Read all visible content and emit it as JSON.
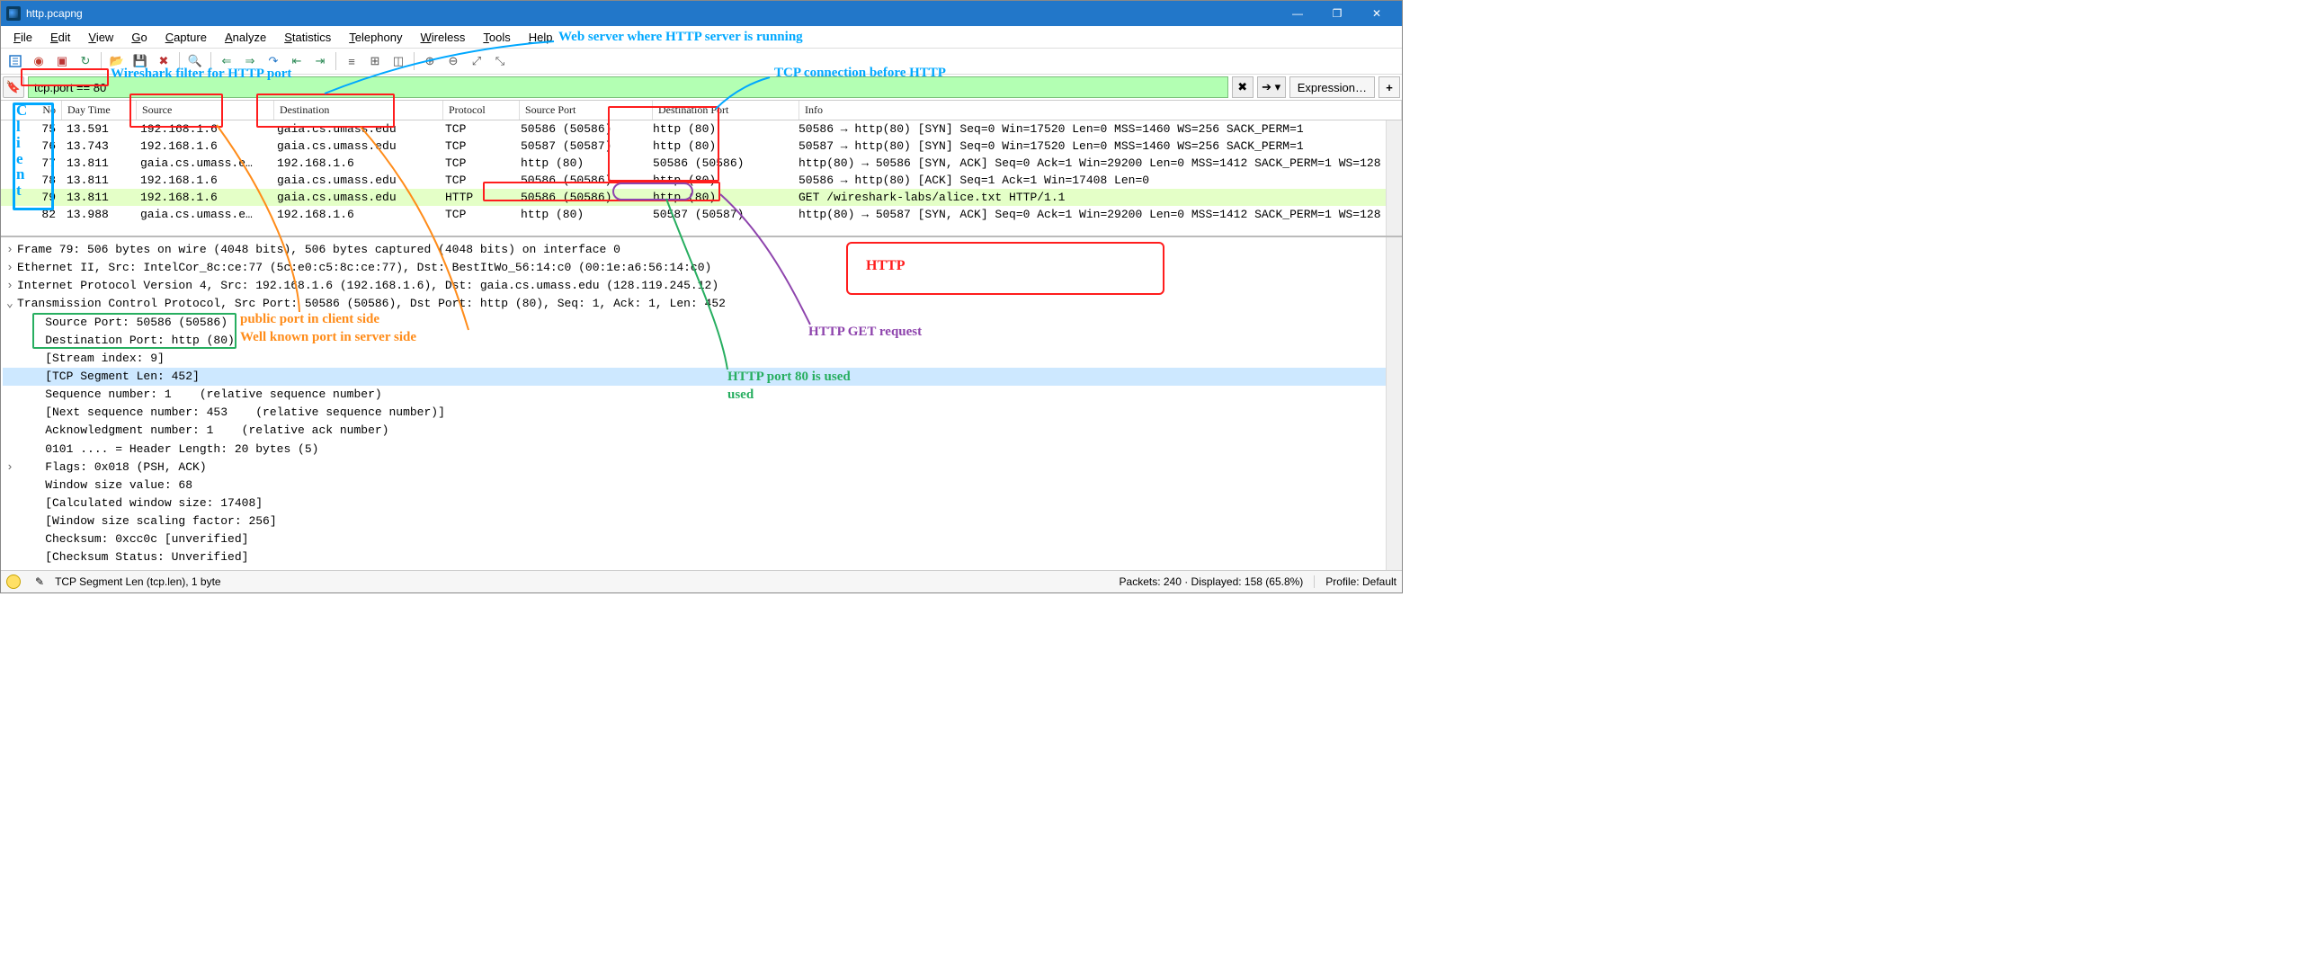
{
  "window": {
    "title": "http.pcapng"
  },
  "menu": [
    "File",
    "Edit",
    "View",
    "Go",
    "Capture",
    "Analyze",
    "Statistics",
    "Telephony",
    "Wireless",
    "Tools",
    "Help"
  ],
  "filter": {
    "value": "tcp.port == 80",
    "expression_label": "Expression…"
  },
  "columns": [
    "No",
    "Day Time",
    "Source",
    "Destination",
    "Protocol",
    "Source Port",
    "Destination Port",
    "Info"
  ],
  "packets": [
    {
      "no": "75",
      "dt": "13.591",
      "src": "192.168.1.6",
      "dst": "gaia.cs.umass.edu",
      "proto": "TCP",
      "sp": "50586 (50586)",
      "dp": "http (80)",
      "info": "50586 → http(80) [SYN] Seq=0 Win=17520 Len=0 MSS=1460 WS=256 SACK_PERM=1"
    },
    {
      "no": "76",
      "dt": "13.743",
      "src": "192.168.1.6",
      "dst": "gaia.cs.umass.edu",
      "proto": "TCP",
      "sp": "50587 (50587)",
      "dp": "http (80)",
      "info": "50587 → http(80) [SYN] Seq=0 Win=17520 Len=0 MSS=1460 WS=256 SACK_PERM=1"
    },
    {
      "no": "77",
      "dt": "13.811",
      "src": "gaia.cs.umass.e…",
      "dst": "192.168.1.6",
      "proto": "TCP",
      "sp": "http (80)",
      "dp": "50586 (50586)",
      "info": "http(80) → 50586 [SYN, ACK] Seq=0 Ack=1 Win=29200 Len=0 MSS=1412 SACK_PERM=1 WS=128"
    },
    {
      "no": "78",
      "dt": "13.811",
      "src": "192.168.1.6",
      "dst": "gaia.cs.umass.edu",
      "proto": "TCP",
      "sp": "50586 (50586)",
      "dp": "http (80)",
      "info": "50586 → http(80) [ACK] Seq=1 Ack=1 Win=17408 Len=0"
    },
    {
      "no": "79",
      "dt": "13.811",
      "src": "192.168.1.6",
      "dst": "gaia.cs.umass.edu",
      "proto": "HTTP",
      "sp": "50586 (50586)",
      "dp": "http (80)",
      "info": "GET /wireshark-labs/alice.txt HTTP/1.1",
      "http": true
    },
    {
      "no": "82",
      "dt": "13.988",
      "src": "gaia.cs.umass.e…",
      "dst": "192.168.1.6",
      "proto": "TCP",
      "sp": "http (80)",
      "dp": "50587 (50587)",
      "info": "http(80) → 50587 [SYN, ACK] Seq=0 Ack=1 Win=29200 Len=0 MSS=1412 SACK_PERM=1 WS=128"
    }
  ],
  "details": [
    {
      "indent": 0,
      "exp": ">",
      "text": "Frame 79: 506 bytes on wire (4048 bits), 506 bytes captured (4048 bits) on interface 0"
    },
    {
      "indent": 0,
      "exp": ">",
      "text": "Ethernet II, Src: IntelCor_8c:ce:77 (5c:e0:c5:8c:ce:77), Dst: BestItWo_56:14:c0 (00:1e:a6:56:14:c0)"
    },
    {
      "indent": 0,
      "exp": ">",
      "text": "Internet Protocol Version 4, Src: 192.168.1.6 (192.168.1.6), Dst: gaia.cs.umass.edu (128.119.245.12)"
    },
    {
      "indent": 0,
      "exp": "v",
      "text": "Transmission Control Protocol, Src Port: 50586 (50586), Dst Port: http (80), Seq: 1, Ack: 1, Len: 452"
    },
    {
      "indent": 1,
      "text": "Source Port: 50586 (50586)"
    },
    {
      "indent": 1,
      "text": "Destination Port: http (80)"
    },
    {
      "indent": 1,
      "text": "[Stream index: 9]"
    },
    {
      "indent": 1,
      "text": "[TCP Segment Len: 452]",
      "hl": true
    },
    {
      "indent": 1,
      "text": "Sequence number: 1    (relative sequence number)"
    },
    {
      "indent": 1,
      "text": "[Next sequence number: 453    (relative sequence number)]"
    },
    {
      "indent": 1,
      "text": "Acknowledgment number: 1    (relative ack number)"
    },
    {
      "indent": 1,
      "text": "0101 .... = Header Length: 20 bytes (5)"
    },
    {
      "indent": 1,
      "exp": ">",
      "text": "Flags: 0x018 (PSH, ACK)"
    },
    {
      "indent": 1,
      "text": "Window size value: 68"
    },
    {
      "indent": 1,
      "text": "[Calculated window size: 17408]"
    },
    {
      "indent": 1,
      "text": "[Window size scaling factor: 256]"
    },
    {
      "indent": 1,
      "text": "Checksum: 0xcc0c [unverified]"
    },
    {
      "indent": 1,
      "text": "[Checksum Status: Unverified]"
    }
  ],
  "status": {
    "field": "TCP Segment Len (tcp.len), 1 byte",
    "packets": "Packets: 240 · Displayed: 158 (65.8%)",
    "profile": "Profile: Default"
  },
  "annotations": {
    "client": "Client",
    "filter": "Wireshark filter for HTTP port",
    "webserver": "Web server where HTTP server is running",
    "tcpbefore": "TCP connection before HTTP",
    "publicport": "public port in client side",
    "wellknown": "Well known port in server side",
    "http80": "HTTP port 80 is used",
    "http80b": "used",
    "httpget": "HTTP GET request",
    "httpbox": "HTTP"
  }
}
